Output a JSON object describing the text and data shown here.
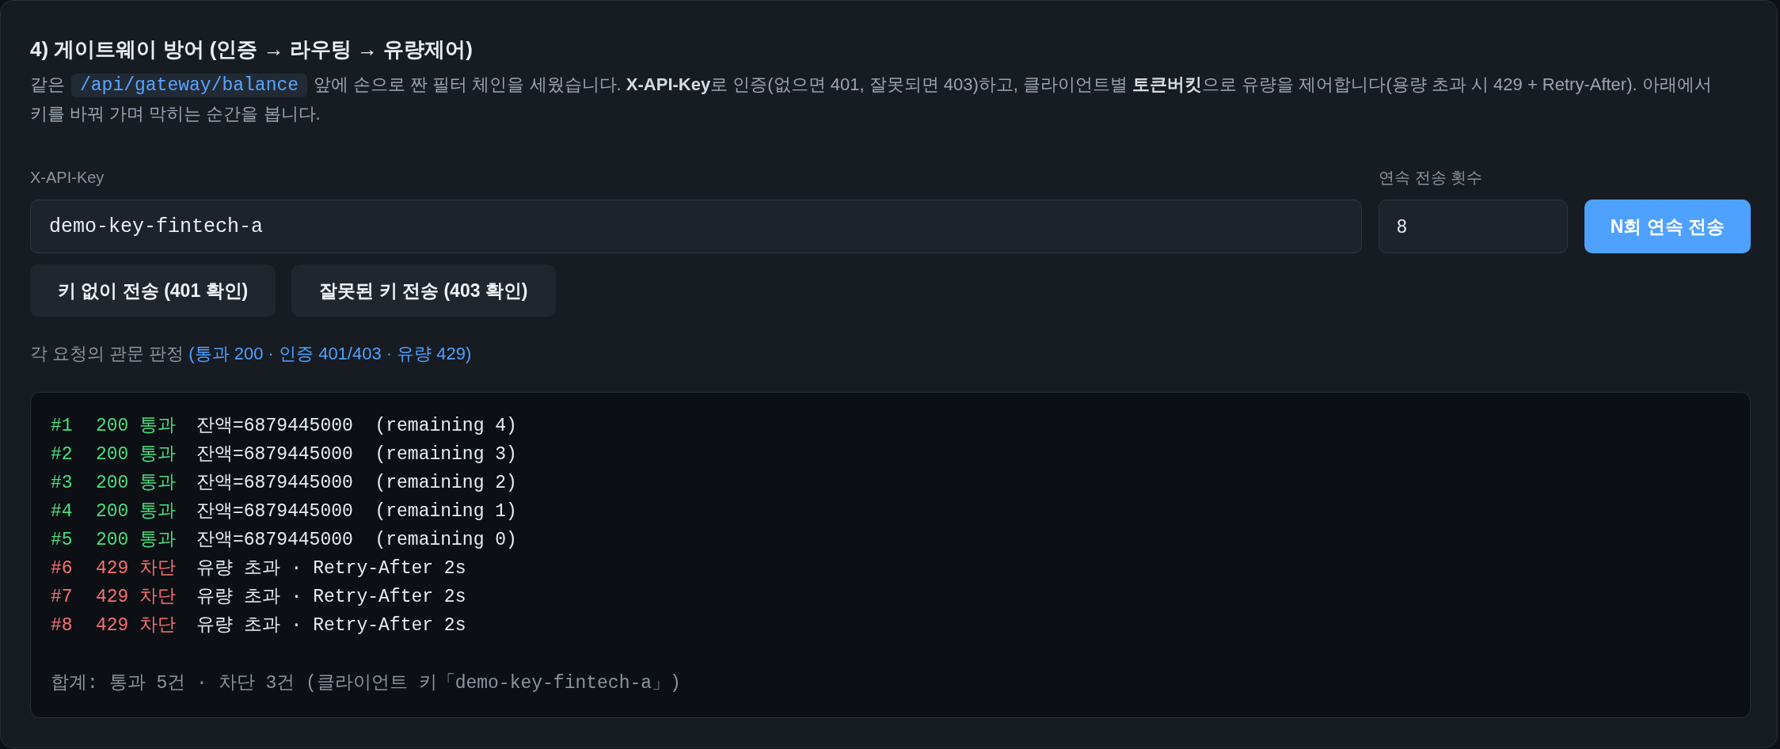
{
  "title": "4) 게이트웨이 방어 (인증 → 라우팅 → 유량제어)",
  "description": {
    "before": "같은",
    "code": "/api/gateway/balance",
    "after": "앞에 손으로 짠 필터 체인을 세웠습니다. **X-API-Key**로 인증(없으면 401, 잘못되면 403)하고, 클라이언트별 **토큰버킷**으로 유량을 제어합니다(용량 초과 시 429 + Retry-After). 아래에서 키를 바꿔 가며 막히는 순간을 봅니다."
  },
  "api_key_field": {
    "label": "X-API-Key",
    "value": "demo-key-fintech-a"
  },
  "count_field": {
    "label": "연속 전송 횟수",
    "value": "8"
  },
  "burst_button": "N회 연속 전송",
  "test_buttons": [
    "키 없이 전송 (401 확인)",
    "잘못된 키 전송 (403 확인)"
  ],
  "verdict": {
    "caption": "각 요청의 관문 판정",
    "legend": "(통과 200 · 인증 401/403 · 유량 429)"
  },
  "log": {
    "lines": [
      {
        "kind": "pass",
        "id": "#1",
        "status": "200 통과",
        "detail": "잔액=6879445000  (remaining 4)"
      },
      {
        "kind": "pass",
        "id": "#2",
        "status": "200 통과",
        "detail": "잔액=6879445000  (remaining 3)"
      },
      {
        "kind": "pass",
        "id": "#3",
        "status": "200 통과",
        "detail": "잔액=6879445000  (remaining 2)"
      },
      {
        "kind": "pass",
        "id": "#4",
        "status": "200 통과",
        "detail": "잔액=6879445000  (remaining 1)"
      },
      {
        "kind": "pass",
        "id": "#5",
        "status": "200 통과",
        "detail": "잔액=6879445000  (remaining 0)"
      },
      {
        "kind": "block",
        "id": "#6",
        "status": "429 차단",
        "detail": "유량 초과 · Retry-After 2s"
      },
      {
        "kind": "block",
        "id": "#7",
        "status": "429 차단",
        "detail": "유량 초과 · Retry-After 2s"
      },
      {
        "kind": "block",
        "id": "#8",
        "status": "429 차단",
        "detail": "유량 초과 · Retry-After 2s"
      }
    ],
    "summary": "합계: 통과 5건 · 차단 3건 (클라이언트 키「demo-key-fintech-a」)"
  }
}
